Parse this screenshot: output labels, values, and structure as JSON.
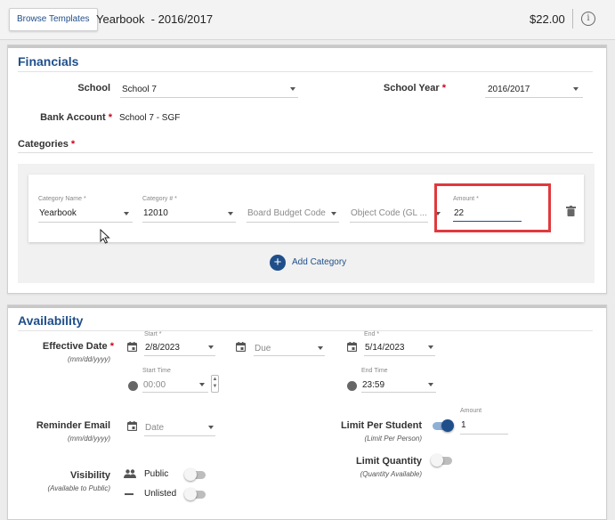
{
  "header": {
    "browse_label": "Browse Templates",
    "title": "Yearbook  - 2016/2017",
    "price": "$22.00",
    "info_icon": "info-icon"
  },
  "financials": {
    "title": "Financials",
    "school_label": "School",
    "school_value": "School 7",
    "school_year_label": "School Year",
    "school_year_value": "2016/2017",
    "bank_account_label": "Bank Account",
    "bank_account_value": "School 7 - SGF",
    "categories_label": "Categories",
    "required_mark": "*",
    "category": {
      "name_label": "Category Name *",
      "name_value": "Yearbook",
      "number_label": "Category # *",
      "number_value": "12010",
      "board_budget_placeholder": "Board Budget Code",
      "object_code_placeholder": "Object Code (GL ...",
      "amount_label": "Amount *",
      "amount_value": "22"
    },
    "add_category_label": "Add Category",
    "add_icon": "+"
  },
  "availability": {
    "title": "Availability",
    "effective_date_label": "Effective Date",
    "effective_date_hint": "(mm/dd/yyyy)",
    "start_label": "Start *",
    "start_value": "2/8/2023",
    "due_placeholder": "Due",
    "end_label": "End *",
    "end_value": "5/14/2023",
    "start_time_label": "Start Time",
    "start_time_value": "00:00",
    "end_time_label": "End Time",
    "end_time_value": "23:59",
    "reminder_email_label": "Reminder Email",
    "reminder_email_hint": "(mm/dd/yyyy)",
    "reminder_date_placeholder": "Date",
    "limit_per_student_label": "Limit Per Student",
    "limit_per_student_hint": "(Limit Per Person)",
    "limit_per_student_on": true,
    "limit_amount_label": "Amount",
    "limit_amount_value": "1",
    "limit_quantity_label": "Limit Quantity",
    "limit_quantity_hint": "(Quantity Available)",
    "limit_quantity_on": false,
    "visibility_label": "Visibility",
    "visibility_hint": "(Available to Public)",
    "public_label": "Public",
    "public_on": false,
    "unlisted_label": "Unlisted",
    "unlisted_on": false
  },
  "colors": {
    "accent": "#1f4f8a",
    "required": "#d0021b",
    "highlight": "#e0393e"
  }
}
